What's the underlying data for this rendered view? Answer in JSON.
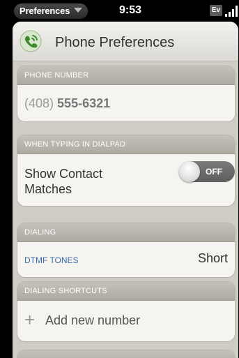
{
  "status_bar": {
    "app_menu_label": "Preferences",
    "time": "9:53",
    "network_badge": "Ev"
  },
  "header": {
    "icon": "phone-icon",
    "title": "Phone Preferences"
  },
  "phone_number": {
    "section_label": "PHONE NUMBER",
    "area_code": "(408)",
    "number": "555-6321"
  },
  "dialpad": {
    "section_label": "WHEN TYPING IN DIALPAD",
    "option_label": "Show Contact Matches",
    "toggle_state": "OFF"
  },
  "dialing": {
    "section_label": "DIALING",
    "option_label": "DTMF TONES",
    "option_value": "Short"
  },
  "shortcuts": {
    "section_label": "DIALING SHORTCUTS",
    "add_label": "Add new number"
  },
  "colors": {
    "accent_link": "#3a6ea5",
    "section_header": "#b9b6ae",
    "background": "#cfccc5"
  }
}
